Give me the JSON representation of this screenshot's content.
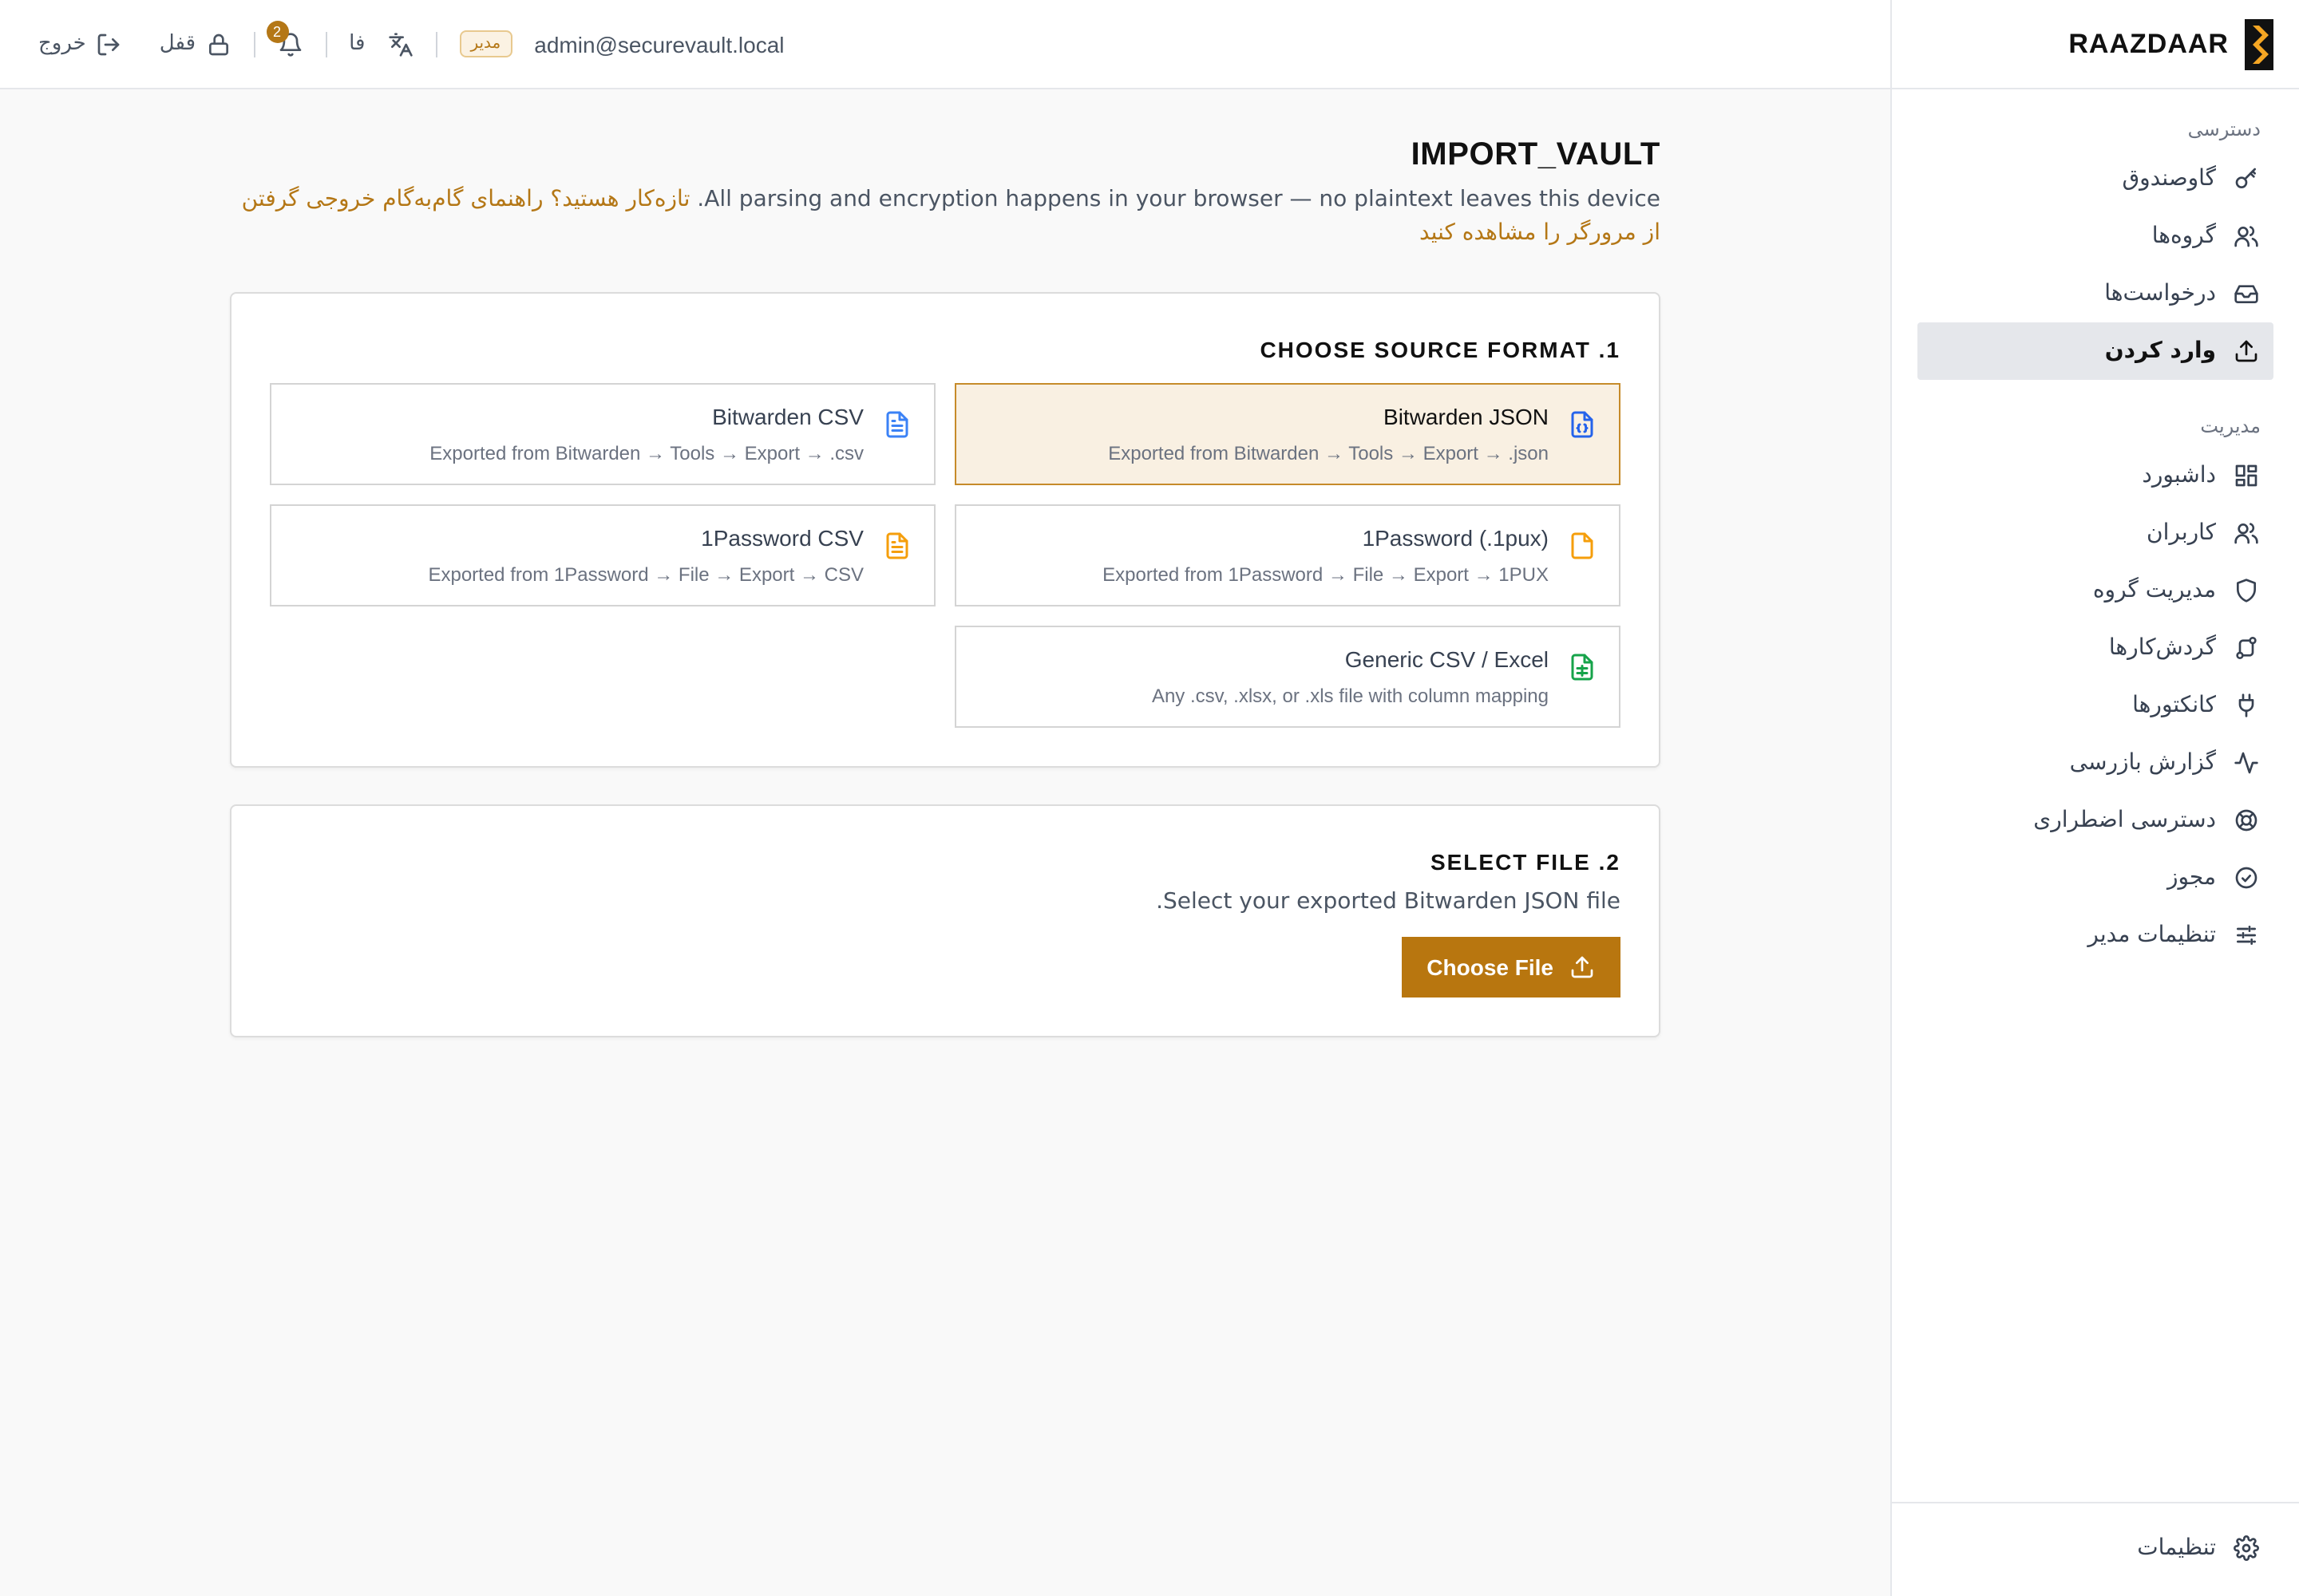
{
  "brand": {
    "name": "RAAZDAAR",
    "logo_colors": [
      "#111111",
      "#f5a623"
    ]
  },
  "topbar": {
    "logout_label": "خروج",
    "lock_label": "قفل",
    "notifications_count": "2",
    "language_label": "فا",
    "role_badge": "مدیر",
    "user_email": "admin@securevault.local"
  },
  "sidebar": {
    "access_section": "دسترسی",
    "access_items": [
      {
        "label": "گاوصندوق",
        "icon": "key-icon"
      },
      {
        "label": "گروه‌ها",
        "icon": "users-icon"
      },
      {
        "label": "درخواست‌ها",
        "icon": "inbox-icon"
      },
      {
        "label": "وارد کردن",
        "icon": "upload-icon",
        "active": true
      }
    ],
    "admin_section": "مدیریت",
    "admin_items": [
      {
        "label": "داشبورد",
        "icon": "dashboard-icon"
      },
      {
        "label": "کاربران",
        "icon": "users-icon"
      },
      {
        "label": "مدیریت گروه",
        "icon": "shield-icon"
      },
      {
        "label": "گردش‌کارها",
        "icon": "workflow-icon"
      },
      {
        "label": "کانکتورها",
        "icon": "plug-icon"
      },
      {
        "label": "گزارش بازرسی",
        "icon": "activity-icon"
      },
      {
        "label": "دسترسی اضطراری",
        "icon": "lifebuoy-icon"
      },
      {
        "label": "مجوز",
        "icon": "badge-check-icon"
      },
      {
        "label": "تنظیمات مدیر",
        "icon": "sliders-icon"
      }
    ],
    "settings_label": "تنظیمات"
  },
  "page": {
    "title": "IMPORT_VAULT",
    "subtitle_text": "All parsing and encryption happens in your browser — no plaintext leaves this device.",
    "subtitle_link": " تازه‌کار هستید؟ راهنمای گام‌به‌گام خروجی گرفتن از مرورگر را مشاهده کنید"
  },
  "step1": {
    "title": "1. CHOOSE SOURCE FORMAT",
    "options": [
      {
        "title": "Bitwarden JSON",
        "desc": "Exported from Bitwarden → Tools → Export → .json",
        "icon": "file-json-icon",
        "color": "#2563eb",
        "selected": true
      },
      {
        "title": "Bitwarden CSV",
        "desc": "Exported from Bitwarden → Tools → Export → .csv",
        "icon": "file-text-icon",
        "color": "#2563eb",
        "selected": false
      },
      {
        "title": "1Password (.1pux)",
        "desc": "Exported from 1Password → File → Export → 1PUX",
        "icon": "file-icon",
        "color": "#f59e0b",
        "selected": false
      },
      {
        "title": "1Password CSV",
        "desc": "Exported from 1Password → File → Export → CSV",
        "icon": "file-text-icon",
        "color": "#f59e0b",
        "selected": false
      },
      {
        "title": "Generic CSV / Excel",
        "desc": "Any .csv, .xlsx, or .xls file with column mapping",
        "icon": "file-spreadsheet-icon",
        "color": "#16a34a",
        "selected": false
      }
    ]
  },
  "step2": {
    "title": "2. SELECT FILE",
    "desc": "Select your exported Bitwarden JSON file.",
    "button_label": "Choose File"
  }
}
